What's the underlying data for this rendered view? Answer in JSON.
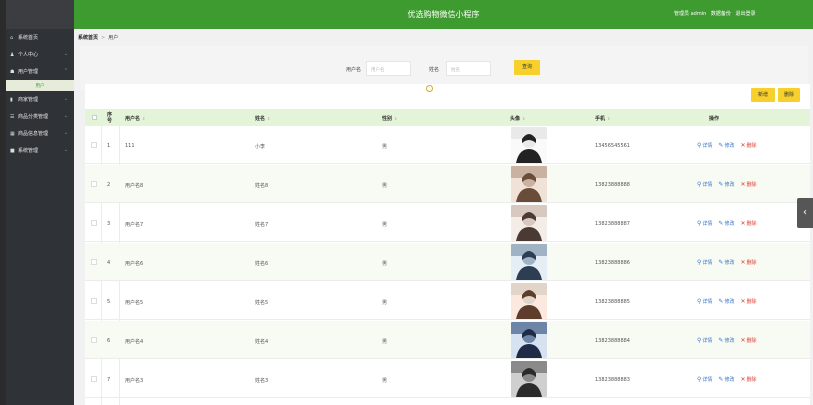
{
  "header": {
    "title": "优选购物微信小程序",
    "role": "管理员 admin",
    "backup": "数据备份",
    "logout": "退出登录"
  },
  "sidebar": {
    "items": [
      {
        "label": "系统首页",
        "icon": "home-icon",
        "glyph": "⌂"
      },
      {
        "label": "个人中心",
        "icon": "person-icon",
        "glyph": "♟"
      },
      {
        "label": "用户管理",
        "icon": "user-icon",
        "glyph": "☗"
      },
      {
        "label": "商家管理",
        "icon": "chart-icon",
        "glyph": "▮"
      },
      {
        "label": "商品分类管理",
        "icon": "list-icon",
        "glyph": "☰"
      },
      {
        "label": "商品信息管理",
        "icon": "grid-icon",
        "glyph": "▦"
      },
      {
        "label": "系统管理",
        "icon": "settings-icon",
        "glyph": "■"
      }
    ],
    "sub_item": "用户"
  },
  "breadcrumb": {
    "home": "系统首页",
    "separator": ">",
    "current": "用户"
  },
  "search": {
    "username_label": "用户名",
    "username_placeholder": "用户名",
    "name_label": "姓名",
    "name_placeholder": "姓名",
    "query_button": "查询"
  },
  "actions": {
    "add": "新增",
    "delete": "删除"
  },
  "table": {
    "columns": [
      "序号",
      "用户名",
      "姓名",
      "性别",
      "头像",
      "手机",
      "操作"
    ],
    "ops": {
      "view": "详情",
      "edit": "修改",
      "delete": "删除"
    },
    "rows": [
      {
        "index": "1",
        "username": "111",
        "name": "小李",
        "gender": "男",
        "phone": "13456545561"
      },
      {
        "index": "2",
        "username": "用户名8",
        "name": "姓名8",
        "gender": "男",
        "phone": "13823888888"
      },
      {
        "index": "3",
        "username": "用户名7",
        "name": "姓名7",
        "gender": "男",
        "phone": "13823888887"
      },
      {
        "index": "4",
        "username": "用户名6",
        "name": "姓名6",
        "gender": "男",
        "phone": "13823888886"
      },
      {
        "index": "5",
        "username": "用户名5",
        "name": "姓名5",
        "gender": "男",
        "phone": "13823888885"
      },
      {
        "index": "6",
        "username": "用户名4",
        "name": "姓名4",
        "gender": "男",
        "phone": "13823888884"
      },
      {
        "index": "7",
        "username": "用户名3",
        "name": "姓名3",
        "gender": "男",
        "phone": "13823888883"
      }
    ]
  },
  "colors": {
    "brand": "#3e9b2f",
    "button": "#f7d02c",
    "link": "#3a73c6",
    "danger": "#e03c31"
  }
}
